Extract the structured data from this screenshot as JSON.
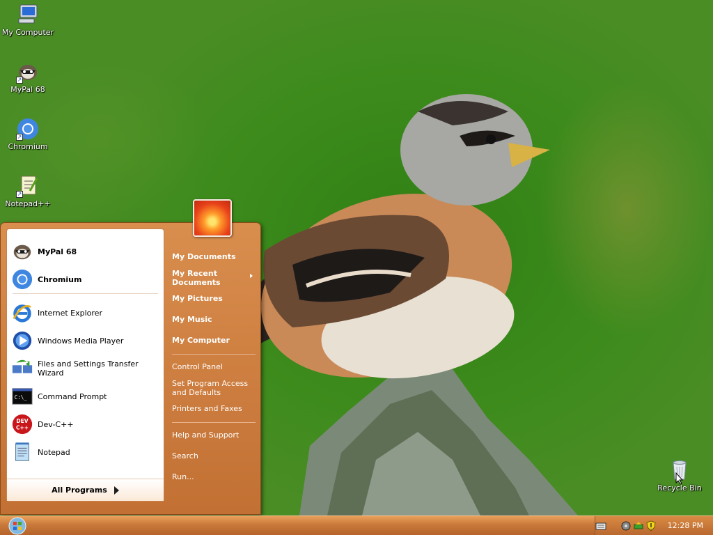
{
  "desktop": {
    "icons": [
      {
        "label": "My Computer",
        "icon": "computer-icon"
      },
      {
        "label": "MyPal 68",
        "icon": "mypal-icon"
      },
      {
        "label": "Chromium",
        "icon": "chromium-icon"
      },
      {
        "label": "Notepad++",
        "icon": "notepadpp-icon"
      },
      {
        "label": "Recycle Bin",
        "icon": "recycle-bin-icon"
      }
    ],
    "wallpaper_subject": "bird-on-stump"
  },
  "start_menu": {
    "pinned": [
      {
        "label": "MyPal 68",
        "icon": "mypal-icon"
      },
      {
        "label": "Chromium",
        "icon": "chromium-icon"
      }
    ],
    "recent": [
      {
        "label": "Internet Explorer",
        "icon": "internet-explorer-icon"
      },
      {
        "label": "Windows Media Player",
        "icon": "media-player-icon"
      },
      {
        "label": "Files and Settings Transfer Wizard",
        "icon": "transfer-wizard-icon"
      },
      {
        "label": "Command Prompt",
        "icon": "command-prompt-icon"
      },
      {
        "label": "Dev-C++",
        "icon": "devcpp-icon"
      },
      {
        "label": "Notepad",
        "icon": "notepad-icon"
      }
    ],
    "all_programs": "All Programs",
    "places": {
      "my_documents": "My Documents",
      "my_recent_documents_1": "My Recent",
      "my_recent_documents_2": "Documents",
      "my_pictures": "My Pictures",
      "my_music": "My Music",
      "my_computer": "My Computer"
    },
    "system": {
      "control_panel": "Control Panel",
      "set_program_access_1": "Set Program Access",
      "set_program_access_2": "and Defaults",
      "printers": "Printers and Faxes"
    },
    "help": {
      "help_support": "Help and Support",
      "search": "Search",
      "run": "Run..."
    }
  },
  "taskbar": {
    "clock": "12:28 PM",
    "tray_icons": [
      "keyboard-icon",
      "network-icon",
      "safely-remove-icon",
      "security-shield-icon"
    ]
  },
  "colors": {
    "start_menu": "#c97a3d",
    "taskbar": "#c9793a",
    "wallpaper": "#3d8b1c"
  }
}
